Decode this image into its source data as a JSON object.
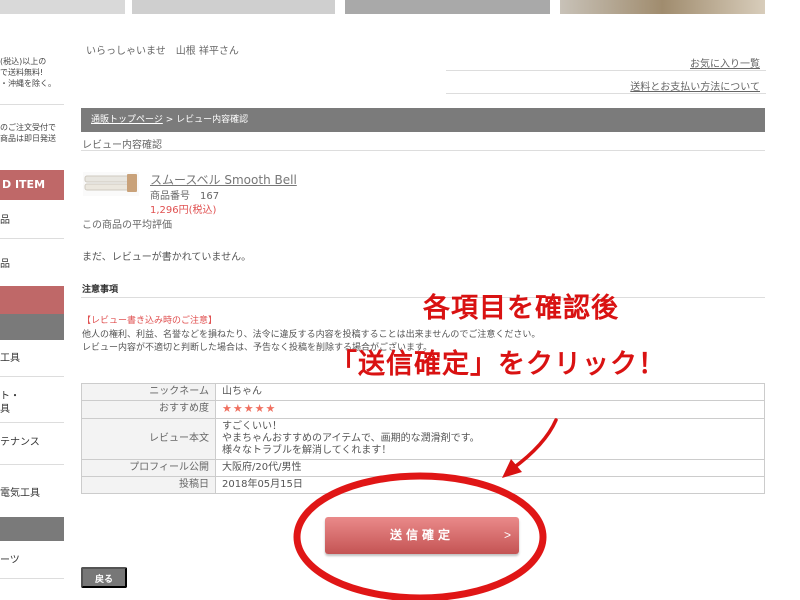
{
  "sidebar": {
    "promo1": "(税込)以上の\nで送料無料!\n・沖縄を除く。",
    "promo2": "のご注文受付で\n商品は即日発送",
    "rank_head": "D ITEM",
    "items1": [
      "品",
      "品"
    ],
    "items2": [
      "工具",
      "ト・\n具",
      "テナンス",
      "電気工具",
      "ーツ"
    ]
  },
  "header": {
    "welcome": "いらっしゃいませ　山根 祥平さん",
    "favorites_link": "お気に入り一覧",
    "shipping_link": "送料とお支払い方法について"
  },
  "breadcrumb": {
    "top": "通販トップページ",
    "sep": " > ",
    "current": "レビュー内容確認"
  },
  "page_subtitle": "レビュー内容確認",
  "product": {
    "name": "スムースベル Smooth Bell",
    "number": "商品番号　167",
    "price": "1,296円(税込)",
    "avg_label": "この商品の平均評価"
  },
  "no_review": "まだ、レビューが書かれていません。",
  "notes_heading": "注意事項",
  "caution": {
    "heading": "【レビュー書き込み時のご注意】",
    "line1": "他人の権利、利益、名誉などを損ねたり、法令に違反する内容を投稿することは出来ませんのでご注意ください。",
    "line2": "レビュー内容が不適切と判断した場合は、予告なく投稿を削除する場合がございます。"
  },
  "review": {
    "nickname_label": "ニックネーム",
    "nickname": "山ちゃん",
    "rating_label": "おすすめ度",
    "rating_stars": "★★★★★",
    "rating_value": 5,
    "body_label": "レビュー本文",
    "body_line1": "すごくいい！",
    "body_line2": "やまちゃんおすすめのアイテムで、画期的な潤滑剤です。",
    "body_line3": "様々なトラブルを解消してくれます！",
    "profile_label": "プロフィール公開",
    "profile": "大阪府/20代/男性",
    "date_label": "投稿日",
    "date": "2018年05月15日"
  },
  "buttons": {
    "submit": "送信確定",
    "submit_chevron": ">",
    "back": "戻る"
  },
  "annotation": {
    "line1": "各項目を確認後",
    "line2": "「送信確定」をクリック！",
    "color": "#d91212"
  },
  "colors": {
    "sidebar_accent": "#bf6868",
    "price": "#e05050",
    "star": "#f07060",
    "bar_gray": "#7b7b7b"
  }
}
